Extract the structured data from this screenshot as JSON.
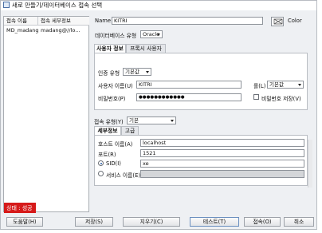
{
  "window": {
    "title": "새로 만들기/데이터베이스 접속 선택"
  },
  "connections": {
    "headers": [
      "접속 이름",
      "접속 세부정보"
    ],
    "rows": [
      {
        "name": "MD_madang",
        "detail": "madang@//lo..."
      }
    ]
  },
  "form": {
    "name_label": "Name",
    "name_value": "KITRI",
    "color_label": "Color",
    "dbtype_label": "데이터베이스 유형",
    "dbtype_value": "Oracle"
  },
  "user_tabs": [
    "사용자 정보",
    "프록시 사용자"
  ],
  "auth": {
    "auth_type_label": "인증 유형",
    "auth_type_value": "기본값",
    "username_label": "사용자 이름(U)",
    "username_value": "KITRI",
    "role_label": "롤(L)",
    "role_value": "기본값",
    "password_label": "비밀번호(P)",
    "password_value": "●●●●●●●●●●●●",
    "save_password_label": "비밀번호 저장(V)"
  },
  "connection_type": {
    "label": "접속 유형(Y)",
    "value": "기본"
  },
  "detail_tabs": [
    "세부정보",
    "고급"
  ],
  "details": {
    "host_label": "호스트 이름(A)",
    "host_value": "localhost",
    "port_label": "포트(R)",
    "port_value": "1521",
    "sid_label": "SID(I)",
    "sid_value": "xe",
    "service_label": "서비스 이름(E)",
    "service_value": ""
  },
  "status": "상태 : 성공",
  "buttons": {
    "help": "도움말(H)",
    "save": "저장(S)",
    "clear": "지우기(C)",
    "test": "테스트(T)",
    "connect": "접속(O)",
    "cancel": "취소"
  }
}
